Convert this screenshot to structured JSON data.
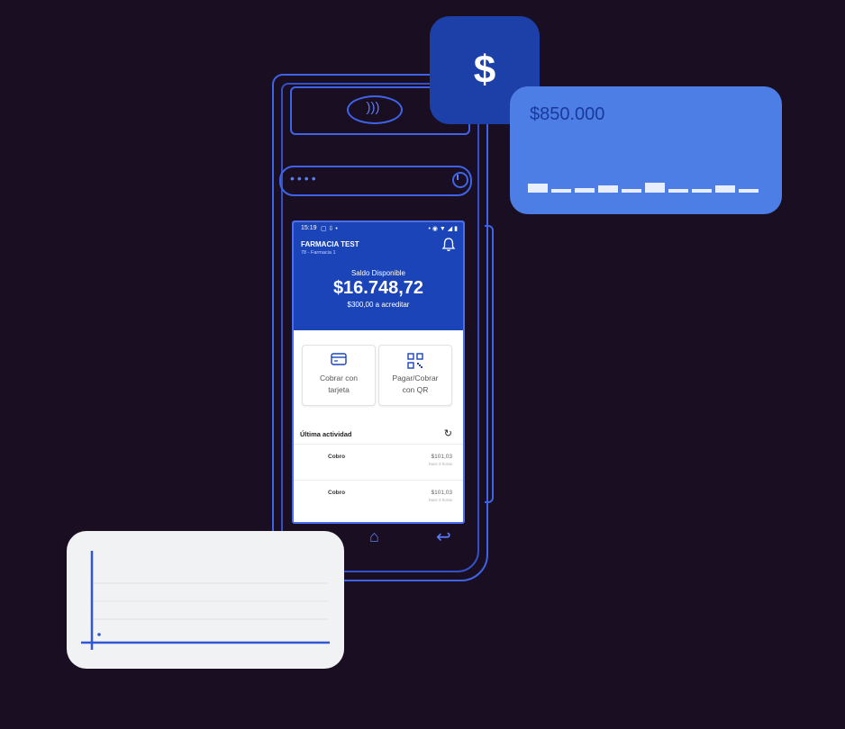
{
  "terminal": {
    "status_time": "15:19",
    "merchant_name": "FARMACIA TEST",
    "merchant_sub": "78 - Farmacia 1",
    "balance_label": "Saldo Disponible",
    "balance_amount": "$16.748,72",
    "balance_pending": "$300,00 a acreditar",
    "actions": [
      {
        "label_line1": "Cobrar con",
        "label_line2": "tarjeta",
        "icon": "credit-card-icon"
      },
      {
        "label_line1": "Pagar/Cobrar",
        "label_line2": "con QR",
        "icon": "qr-code-icon"
      }
    ],
    "activity_title": "Última actividad",
    "activity": [
      {
        "label": "Cobro",
        "amount": "$101,03",
        "sub": "hace 3 horas"
      },
      {
        "label": "Cobro",
        "amount": "$101,03",
        "sub": "hace 3 horas"
      }
    ]
  },
  "badge": {
    "symbol": "$"
  },
  "amount_card": {
    "value": "$850.000"
  },
  "colors": {
    "background": "#1a0f22",
    "outline": "#3f63e8",
    "header": "#1a44b8",
    "amount_card": "#4d7ee6",
    "badge": "#1c3fa8"
  }
}
